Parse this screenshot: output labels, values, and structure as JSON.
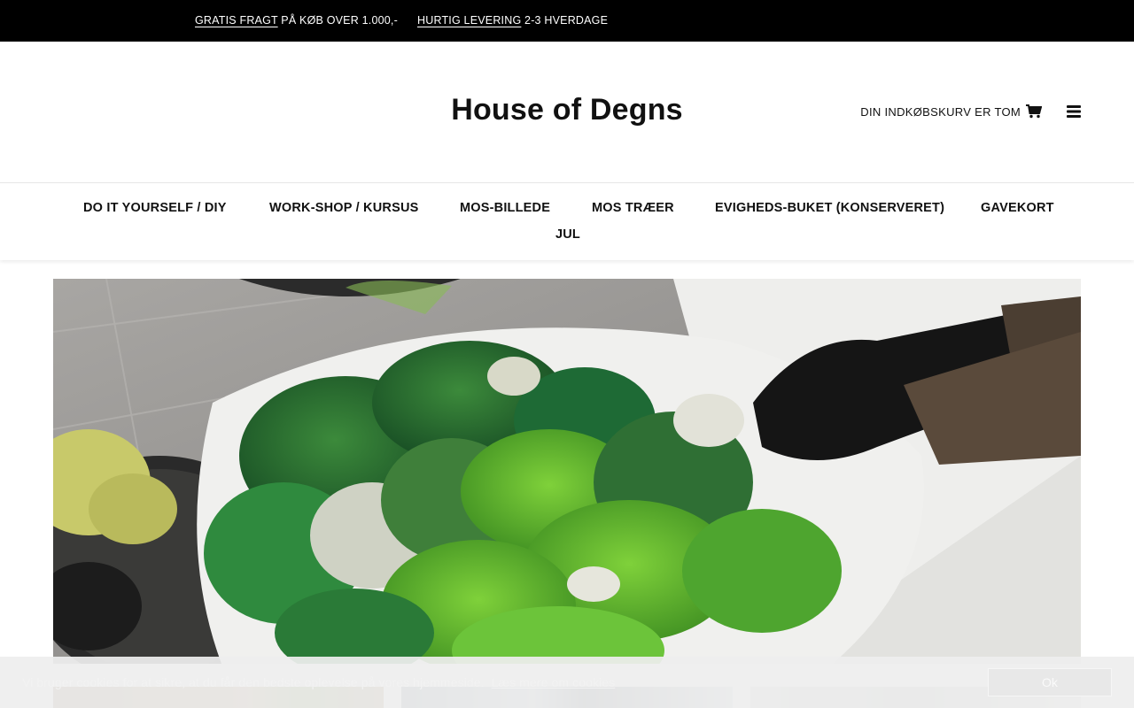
{
  "topbar": {
    "usp1": {
      "emph": "GRATIS FRAGT",
      "rest": " PÅ KØB OVER 1.000,-"
    },
    "usp2": {
      "emph": "HURTIG LEVERING",
      "rest": " 2-3 HVERDAGE"
    }
  },
  "header": {
    "logo": "House of Degns",
    "cart_label": "DIN INDKØBSKURV ER TOM",
    "cart_icon": "shopping-cart-icon",
    "menu_icon": "hamburger-menu-icon"
  },
  "nav": {
    "items": [
      "DO IT YOURSELF / DIY",
      "WORK-SHOP / KURSUS",
      "MOS-BILLEDE",
      "MOS TRÆER",
      "EVIGHEDS-BUKET (KONSERVERET)",
      "GAVEKORT",
      "JUL"
    ]
  },
  "cookie": {
    "message": "Vi bruger cookies for at sikre, at du får den bedste oplevelse på vores hjemmeside.",
    "link": "Læs mere om cookies",
    "button": "Ok"
  },
  "colors": {
    "topbar_bg": "#000000",
    "moss_green": "#5fb52f",
    "dark_green": "#1f6b2e"
  }
}
